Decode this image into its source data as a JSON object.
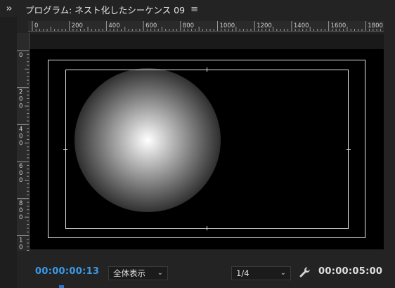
{
  "panel": {
    "title": "プログラム: ネスト化したシーケンス 09",
    "menu_icon": "hamburger-icon",
    "expand_icon": "double-chevron-right-icon"
  },
  "ruler": {
    "horizontal_labels": [
      "0",
      "200",
      "400",
      "600",
      "800",
      "1000",
      "1200",
      "1400",
      "1600",
      "1800"
    ],
    "vertical_labels": [
      "0",
      "200",
      "400",
      "600",
      "800",
      "1000"
    ]
  },
  "controls": {
    "current_time": "00:00:00:13",
    "zoom": "全体表示",
    "resolution": "1/4",
    "duration": "00:00:05:00",
    "settings_icon": "wrench-icon"
  },
  "colors": {
    "accent": "#3a9bea",
    "background": "#232323"
  }
}
